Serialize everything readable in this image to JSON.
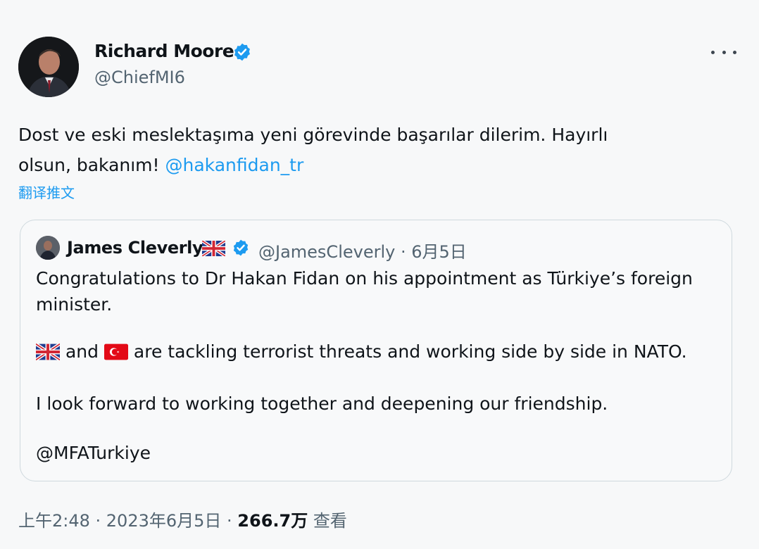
{
  "author": {
    "name": "Richard Moore",
    "handle": "@ChiefMI6"
  },
  "tweet": {
    "text_line1": "Dost ve eski meslektaşıma yeni görevinde başarılar dilerim.  Hayırlı",
    "text_line2": "olsun, bakanım! ",
    "mention": "@hakanfidan_tr",
    "translate_label": "翻译推文"
  },
  "quoted": {
    "name": "James Cleverly",
    "handle_date": "@JamesCleverly · 6月5日",
    "line1": "Congratulations to Dr Hakan Fidan on his appointment as Türkiye’s foreign",
    "line2": "minister.",
    "line3_a": "and",
    "line3_b": "are tackling terrorist threats and working side by side in NATO.",
    "line4": "I look forward to working together and deepening our friendship.",
    "line5": "@MFATurkiye"
  },
  "footer": {
    "time_date": "上午2:48 · 2023年6月5日 · ",
    "views": "266.7万",
    "views_label": " 查看"
  },
  "colors": {
    "link": "#1d9bf0",
    "verified": "#1d9bf0",
    "secondary_text": "#536471"
  },
  "icons": [
    "verified-badge-icon",
    "more-options-icon",
    "uk-flag-icon",
    "turkey-flag-icon"
  ]
}
